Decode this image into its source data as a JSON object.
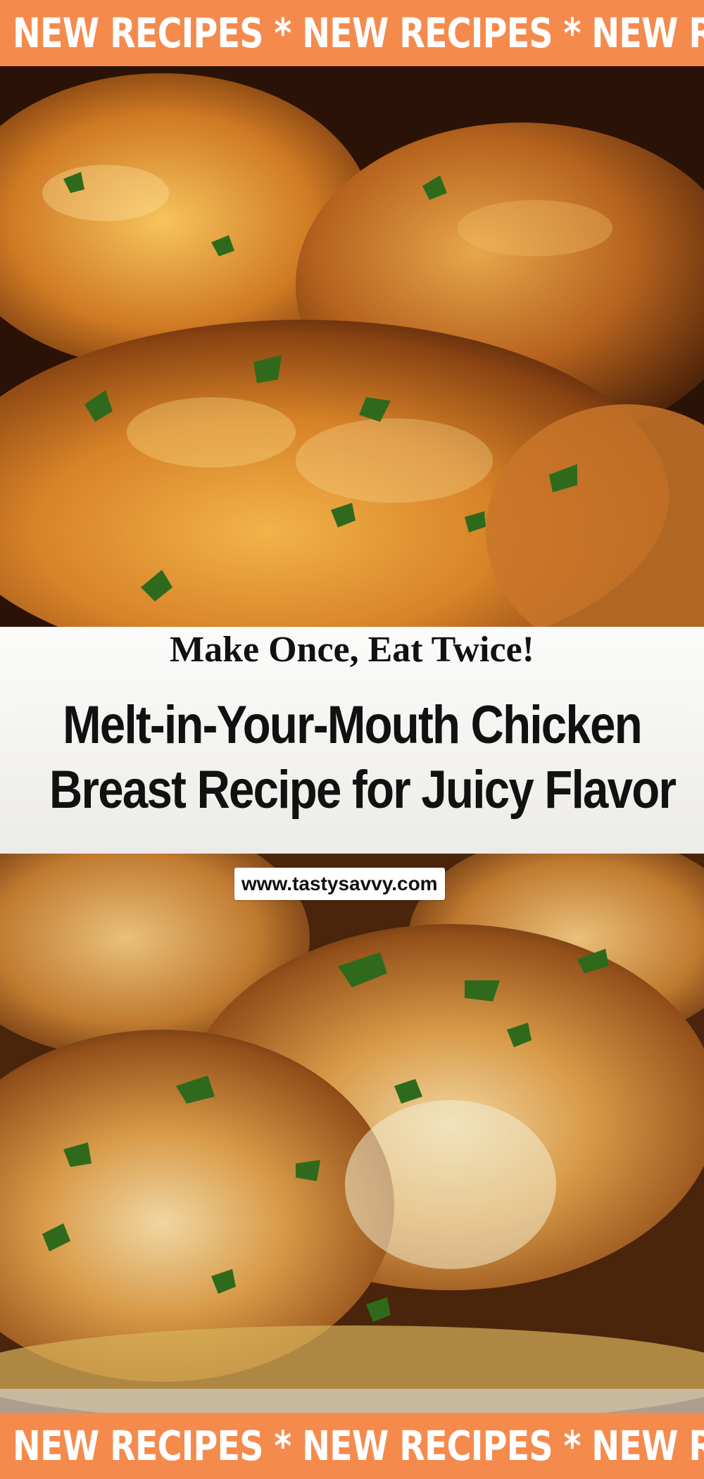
{
  "banners": {
    "top_text": "NEW RECIPES * NEW RECIPES * NEW  RECI",
    "bottom_text": "NEW RECIPES * NEW RECIPES * NEW  RECI",
    "color": "#f58a4d"
  },
  "images": {
    "top": "glazed-chicken-thighs-photo",
    "bottom": "pan-seared-chicken-breast-photo"
  },
  "tagline": "Make Once, Eat Twice!",
  "title": {
    "line1": "Melt-in-Your-Mouth Chicken",
    "line2": "Breast Recipe for Juicy Flavor"
  },
  "website": "www.tastysavvy.com"
}
